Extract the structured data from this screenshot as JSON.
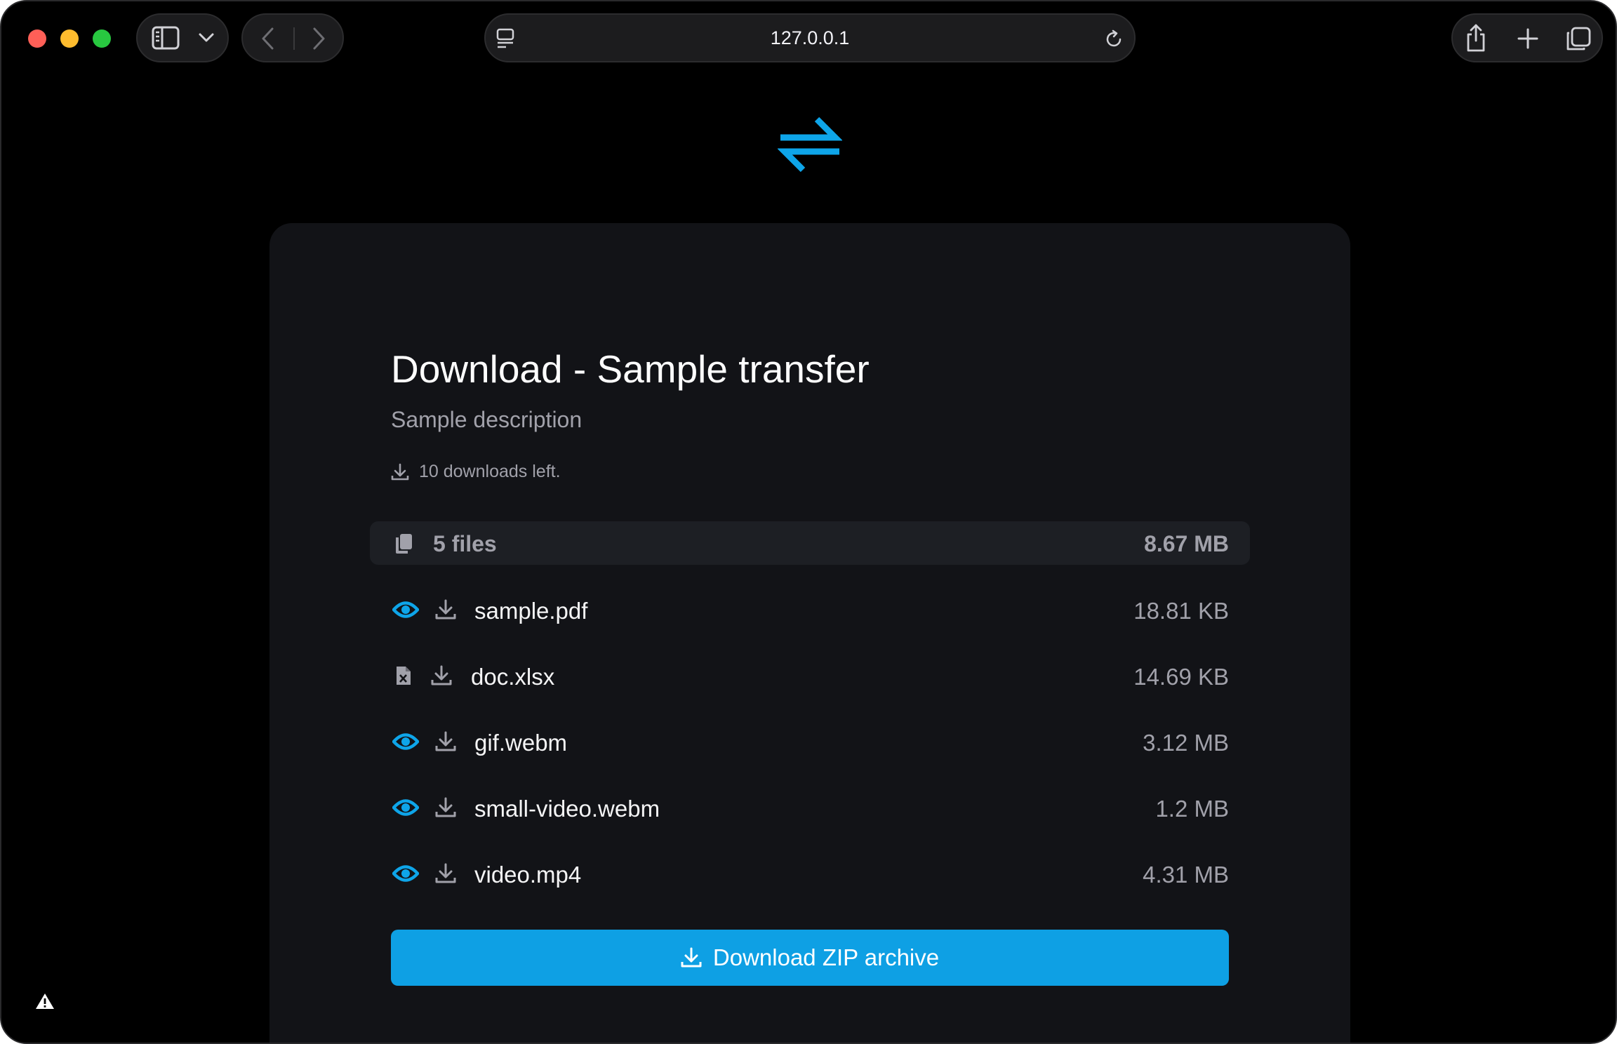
{
  "browser": {
    "url": "127.0.0.1"
  },
  "page": {
    "title": "Download - Sample transfer",
    "description": "Sample description",
    "downloads_left": "10 downloads left."
  },
  "summary": {
    "files_count": "5 files",
    "total_size": "8.67 MB"
  },
  "files": [
    {
      "name": "sample.pdf",
      "size": "18.81 KB",
      "type_icon": "eye-icon"
    },
    {
      "name": "doc.xlsx",
      "size": "14.69 KB",
      "type_icon": "excel-file-icon"
    },
    {
      "name": "gif.webm",
      "size": "3.12 MB",
      "type_icon": "eye-icon"
    },
    {
      "name": "small-video.webm",
      "size": "1.2 MB",
      "type_icon": "eye-icon"
    },
    {
      "name": "video.mp4",
      "size": "4.31 MB",
      "type_icon": "eye-icon"
    }
  ],
  "actions": {
    "zip_label": "Download ZIP archive"
  },
  "colors": {
    "accent": "#0ea0e4",
    "card_bg": "#121317",
    "page_bg": "#000000"
  }
}
